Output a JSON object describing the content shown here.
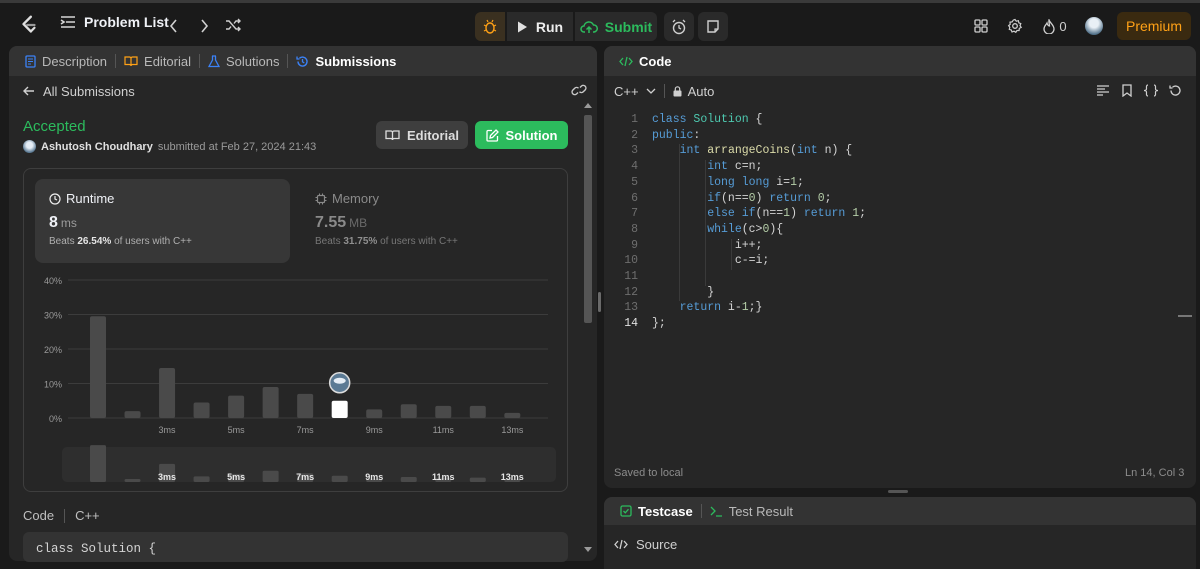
{
  "topbar": {
    "problem_list_label": "Problem List",
    "run_label": "Run",
    "submit_label": "Submit",
    "streak_count": "0",
    "premium_label": "Premium"
  },
  "left_panel": {
    "tabs": [
      {
        "label": "Description",
        "icon": "description-icon"
      },
      {
        "label": "Editorial",
        "icon": "book-icon"
      },
      {
        "label": "Solutions",
        "icon": "flask-icon"
      },
      {
        "label": "Submissions",
        "icon": "history-icon",
        "active": true
      }
    ],
    "back_label": "All Submissions",
    "status": "Accepted",
    "status_color": "#2cbb5d",
    "submitter": "Ashutosh Choudhary",
    "submitted_text": "submitted at Feb 27, 2024 21:43",
    "editorial_button": "Editorial",
    "solution_button": "Solution",
    "runtime": {
      "title": "Runtime",
      "value": "8",
      "unit": "ms",
      "beats_prefix": "Beats",
      "beats_pct": "26.54%",
      "beats_suffix": "of users with C++"
    },
    "memory": {
      "title": "Memory",
      "value": "7.55",
      "unit": "MB",
      "beats_prefix": "Beats",
      "beats_pct": "31.75%",
      "beats_suffix": "of users with C++"
    },
    "code_label": "Code",
    "code_lang": "C++",
    "code_preview": "class Solution {"
  },
  "chart_data": {
    "type": "bar",
    "y_ticks": [
      "40%",
      "30%",
      "20%",
      "10%",
      "0%"
    ],
    "ylim": [
      0,
      40
    ],
    "x_tick_labels": [
      "3ms",
      "5ms",
      "7ms",
      "9ms",
      "11ms",
      "13ms"
    ],
    "values": [
      29.5,
      2,
      14.5,
      4.5,
      6.5,
      9,
      7,
      5,
      2.5,
      4,
      3.5,
      3.5,
      1.5
    ],
    "highlight_index": 7,
    "highlight_color": "#ffffff",
    "bar_color": "#4a4a4a",
    "grid": true
  },
  "code_panel": {
    "title": "Code",
    "language": "C++",
    "mode": "Auto",
    "lines": [
      {
        "n": "1",
        "t": "class Solution {"
      },
      {
        "n": "2",
        "t": "public:"
      },
      {
        "n": "3",
        "t": "    int arrangeCoins(int n) {"
      },
      {
        "n": "4",
        "t": "        int c=n;"
      },
      {
        "n": "5",
        "t": "        long long i=1;"
      },
      {
        "n": "6",
        "t": "        if(n==0) return 0;"
      },
      {
        "n": "7",
        "t": "        else if(n==1) return 1;"
      },
      {
        "n": "8",
        "t": "        while(c>0){"
      },
      {
        "n": "9",
        "t": "            i++;"
      },
      {
        "n": "10",
        "t": "            c-=i;"
      },
      {
        "n": "11",
        "t": ""
      },
      {
        "n": "12",
        "t": "        }"
      },
      {
        "n": "13",
        "t": "    return i-1;}"
      },
      {
        "n": "14",
        "t": "};"
      }
    ],
    "current_line": "14",
    "saved_text": "Saved to local",
    "cursor_pos": "Ln 14, Col 3"
  },
  "test_panel": {
    "testcase_label": "Testcase",
    "result_label": "Test Result",
    "source_label": "Source"
  }
}
